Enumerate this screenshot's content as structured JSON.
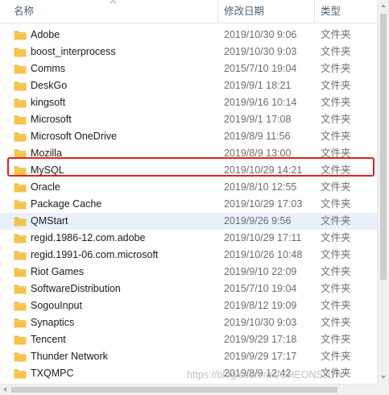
{
  "columns": {
    "name": "名称",
    "date": "修改日期",
    "type": "类型"
  },
  "icons": {
    "folder": "folder-icon",
    "sort": "sort-up-arrow-icon"
  },
  "colors": {
    "folder_fill": "#f5c34b",
    "highlight": "#e02020",
    "selection": "#e8f1fb"
  },
  "rows": [
    {
      "name": "Adobe",
      "date": "2019/10/30 9:06",
      "type": "文件夹"
    },
    {
      "name": "boost_interprocess",
      "date": "2019/10/30 9:03",
      "type": "文件夹"
    },
    {
      "name": "Comms",
      "date": "2015/7/10 19:04",
      "type": "文件夹"
    },
    {
      "name": "DeskGo",
      "date": "2019/9/1 18:21",
      "type": "文件夹"
    },
    {
      "name": "kingsoft",
      "date": "2019/9/16 10:14",
      "type": "文件夹"
    },
    {
      "name": "Microsoft",
      "date": "2019/9/1 17:08",
      "type": "文件夹"
    },
    {
      "name": "Microsoft OneDrive",
      "date": "2019/8/9 11:56",
      "type": "文件夹"
    },
    {
      "name": "Mozilla",
      "date": "2019/8/9 13:00",
      "type": "文件夹"
    },
    {
      "name": "MySQL",
      "date": "2019/10/29 14:21",
      "type": "文件夹"
    },
    {
      "name": "Oracle",
      "date": "2019/8/10 12:55",
      "type": "文件夹"
    },
    {
      "name": "Package Cache",
      "date": "2019/10/29 17:03",
      "type": "文件夹"
    },
    {
      "name": "QMStart",
      "date": "2019/9/26 9:56",
      "type": "文件夹"
    },
    {
      "name": "regid.1986-12.com.adobe",
      "date": "2019/10/29 17:11",
      "type": "文件夹"
    },
    {
      "name": "regid.1991-06.com.microsoft",
      "date": "2019/10/26 10:48",
      "type": "文件夹"
    },
    {
      "name": "Riot Games",
      "date": "2019/9/10 22:09",
      "type": "文件夹"
    },
    {
      "name": "SoftwareDistribution",
      "date": "2015/7/10 19:04",
      "type": "文件夹"
    },
    {
      "name": "SogouInput",
      "date": "2019/8/12 19:09",
      "type": "文件夹"
    },
    {
      "name": "Synaptics",
      "date": "2019/10/30 9:03",
      "type": "文件夹"
    },
    {
      "name": "Tencent",
      "date": "2019/9/29 17:18",
      "type": "文件夹"
    },
    {
      "name": "Thunder Network",
      "date": "2019/9/29 17:17",
      "type": "文件夹"
    },
    {
      "name": "TXQMPC",
      "date": "2019/8/9 12:42",
      "type": "文件夹"
    }
  ],
  "selected_row": "QMStart",
  "highlighted_row": "MySQL",
  "watermark": "https://blog.csdn.net/CHEONSJUN"
}
